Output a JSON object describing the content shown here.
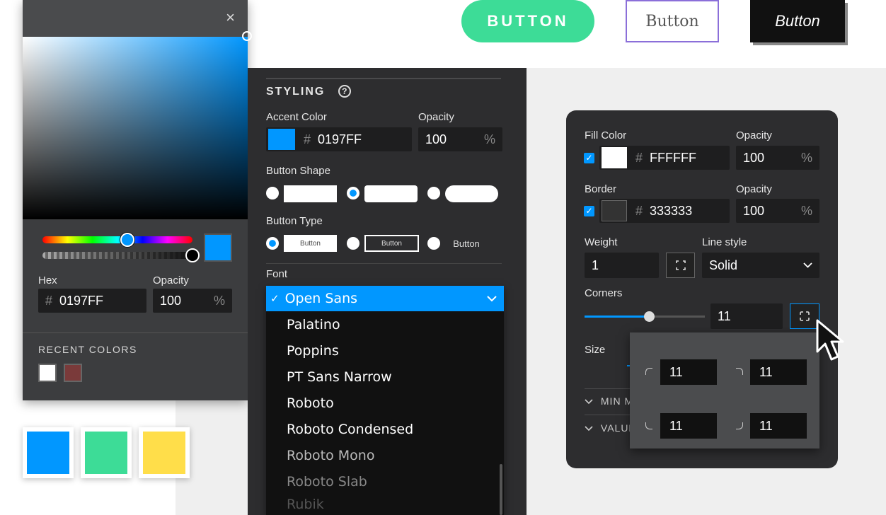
{
  "top_buttons": {
    "filled": "BUTTON",
    "outline": "Button",
    "dark": "Button"
  },
  "color_picker": {
    "close": "×",
    "hex_label": "Hex",
    "hex_value": "0197FF",
    "hash": "#",
    "opacity_label": "Opacity",
    "opacity_value": "100",
    "pct": "%",
    "recent_title": "RECENT COLORS",
    "recent_colors": [
      "#ffffff",
      "#7a3a3a"
    ],
    "current_color": "#0197ff"
  },
  "swatches": [
    "#0197ff",
    "#3ddc97",
    "#ffde4a"
  ],
  "styling": {
    "title": "STYLING",
    "help": "?",
    "accent_label": "Accent Color",
    "accent_value": "0197FF",
    "opacity_label": "Opacity",
    "opacity_value": "100",
    "shape_label": "Button Shape",
    "type_label": "Button Type",
    "type_buttons": [
      "Button",
      "Button",
      "Button"
    ],
    "font_label": "Font",
    "font_selected": "Open Sans",
    "check": "✓",
    "font_options": [
      "Palatino",
      "Poppins",
      "PT Sans Narrow",
      "Roboto",
      "Roboto Condensed",
      "Roboto Mono",
      "Roboto Slab",
      "Rubik"
    ]
  },
  "props": {
    "fill_label": "Fill Color",
    "fill_value": "FFFFFF",
    "opacity_label": "Opacity",
    "fill_opacity": "100",
    "border_label": "Border",
    "border_value": "333333",
    "border_opacity": "100",
    "weight_label": "Weight",
    "weight_value": "1",
    "line_label": "Line style",
    "line_value": "Solid",
    "corners_label": "Corners",
    "corners_value": "11",
    "size_label": "Size",
    "min_label": "MIN M",
    "value_label": "VALUE",
    "corner_values": [
      "11",
      "11",
      "11",
      "11"
    ]
  }
}
